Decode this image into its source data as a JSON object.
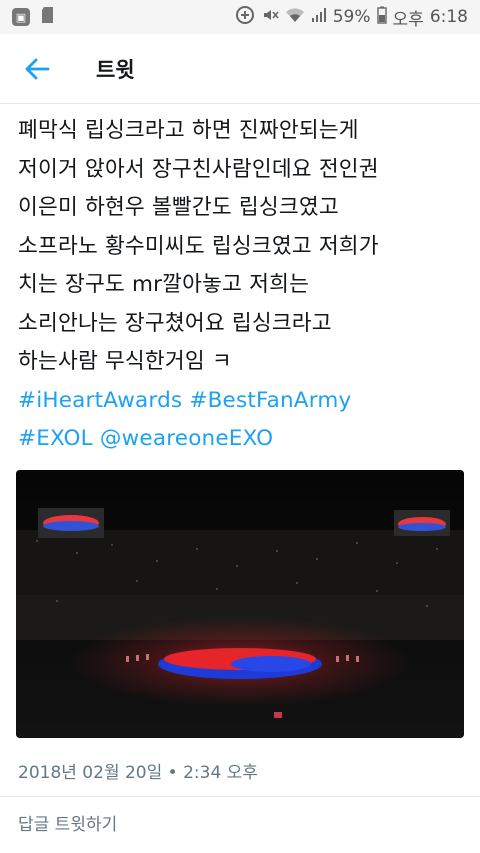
{
  "status_bar": {
    "battery": "59%",
    "ampm": "오후",
    "time": "6:18",
    "icons": [
      "app-icon",
      "sd-card-icon",
      "data-saver-icon",
      "mute-icon",
      "wifi-icon",
      "signal-icon",
      "battery-icon"
    ]
  },
  "header": {
    "title": "트윗",
    "back_icon": "arrow-left-icon"
  },
  "tweet": {
    "lines": [
      "폐막식 립싱크라고 하면 진짜안되는게",
      "저이거 앉아서 장구친사람인데요 전인권",
      "이은미 하현우 볼빨간도 립싱크였고",
      "소프라노 황수미씨도 립싱크였고 저희가",
      "치는 장구도 mr깔아놓고 저희는",
      "소리안나는 장구쳤어요 립싱크라고",
      "하는사람 무식한거임 ㅋ"
    ],
    "hashtag_iheart": "#iHeartAwards",
    "hashtag_bestfanarmy": "#BestFanArmy",
    "hashtag_exol": "#EXOL",
    "mention": "@weareoneEXO",
    "timestamp": "2018년 02월 20일 • 2:34 오후"
  },
  "reply": {
    "placeholder": "답글 트윗하기"
  },
  "colors": {
    "link": "#1da1f2",
    "text": "#14171a",
    "muted": "#657786",
    "divider": "#e1e8ed"
  }
}
